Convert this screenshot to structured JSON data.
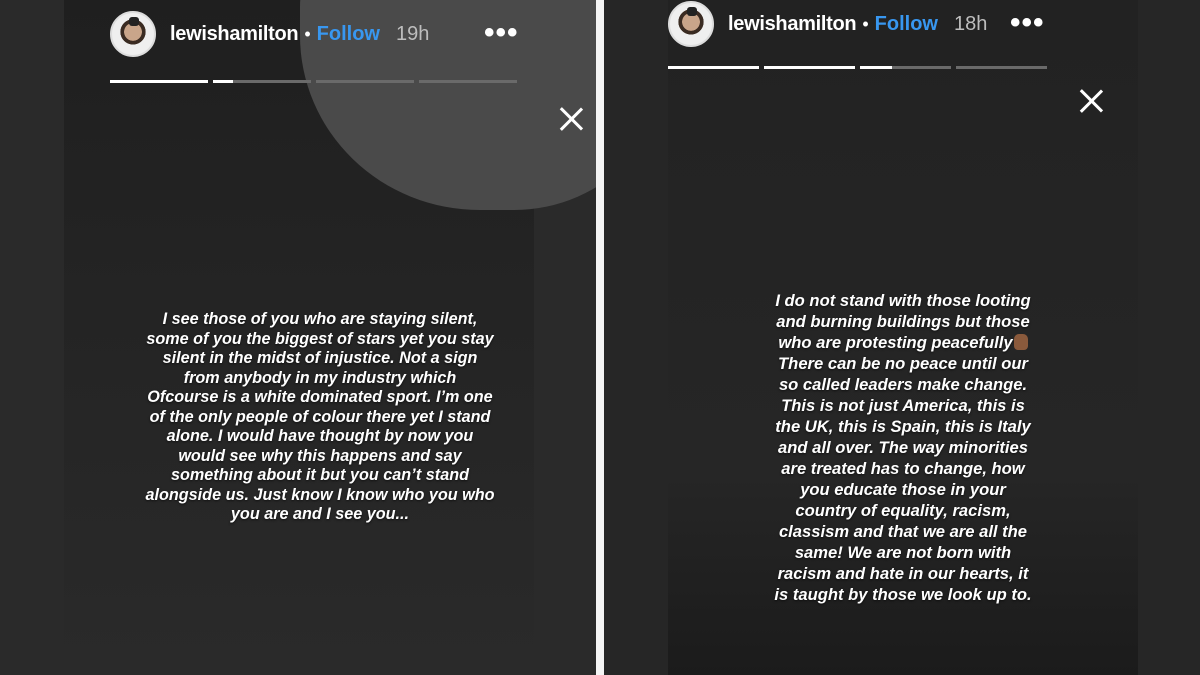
{
  "stories": [
    {
      "username": "lewishamilton",
      "separator": "•",
      "follow_label": "Follow",
      "time": "19h",
      "more_icon": "•••",
      "progress": [
        1,
        0.2,
        0,
        0
      ],
      "lines": [
        "I see those of you who are staying silent,",
        "some of you the biggest of stars yet you stay",
        "silent in the midst of injustice. Not a sign",
        "from anybody in my industry which",
        "Ofcourse is a white dominated sport. I’m one",
        "of the only people of colour there yet I stand",
        "alone. I would have thought by now you",
        "would see why this happens and say",
        "something about it but you can’t stand",
        "alongside us. Just know I know who you who",
        "you are and I see you..."
      ]
    },
    {
      "username": "lewishamilton",
      "separator": "•",
      "follow_label": "Follow",
      "time": "18h",
      "more_icon": "•••",
      "progress": [
        1,
        1,
        0.35,
        0
      ],
      "lines": [
        "I do not stand with those looting",
        "and burning buildings but those",
        "who are protesting peacefully",
        "There can be no peace until our",
        "so called leaders make change.",
        "This is not just America, this is",
        "the UK, this is Spain, this is Italy",
        "and all over. The way minorities",
        "are treated has to change, how",
        "you educate those in your",
        "country of equality, racism,",
        "classism and that we are all the",
        "same! We are not born with",
        "racism and hate in our hearts, it",
        "is taught by those we look up to."
      ],
      "emoji_after_line": 2
    }
  ]
}
